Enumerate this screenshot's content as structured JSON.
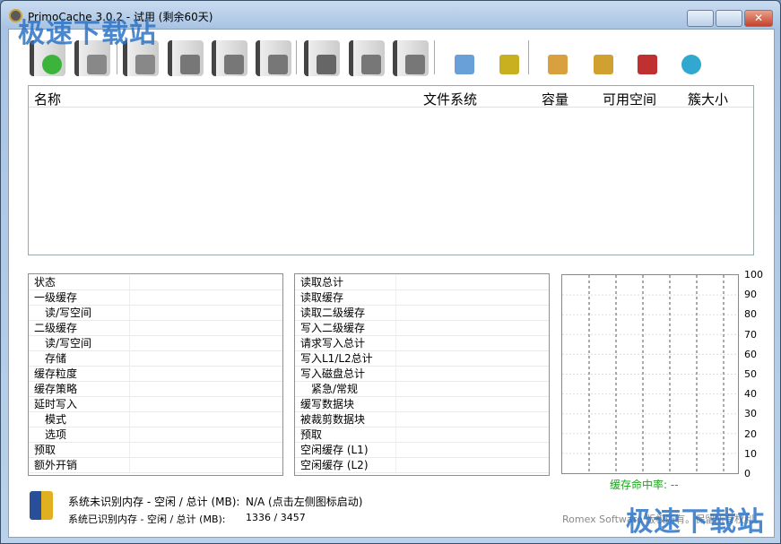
{
  "window": {
    "title": "PrimoCache 3.0.2 - 试用 (剩余60天)",
    "minimize": "—",
    "maximize": "□",
    "close": "✕"
  },
  "watermark": "极速下载站",
  "toolbar": [
    {
      "icon": "add-disk-icon",
      "color": "#3cb43c"
    },
    {
      "icon": "disk-options-icon",
      "color": "#888"
    },
    {
      "icon": "disk-search-icon",
      "color": "#888"
    },
    {
      "icon": "disk-delete-icon",
      "color": "#777"
    },
    {
      "icon": "disk-pause-icon",
      "color": "#777"
    },
    {
      "icon": "disk-play-icon",
      "color": "#777"
    },
    {
      "icon": "timed-download-icon",
      "color": "#666"
    },
    {
      "icon": "timed-pause-icon",
      "color": "#777"
    },
    {
      "icon": "timed-play-icon",
      "color": "#777"
    },
    {
      "icon": "disk-settings-icon",
      "color": "#6aa0d8"
    },
    {
      "icon": "chip-settings-icon",
      "color": "#c8b020"
    },
    {
      "icon": "package-settings-icon",
      "color": "#d9a040"
    },
    {
      "icon": "lock-key-icon",
      "color": "#d0a030"
    },
    {
      "icon": "help-book-icon",
      "color": "#c03030"
    },
    {
      "icon": "info-icon",
      "color": "#30a8d0"
    }
  ],
  "list": {
    "columns": [
      "名称",
      "文件系统",
      "容量",
      "可用空间",
      "簇大小"
    ]
  },
  "left_panel": [
    "状态",
    "一级缓存",
    "读/写空间",
    "二级缓存",
    "读/写空间",
    "存储",
    "缓存粒度",
    "缓存策略",
    "延时写入",
    "模式",
    "选项",
    "预取",
    "额外开销"
  ],
  "left_indent": [
    0,
    0,
    1,
    0,
    1,
    1,
    0,
    0,
    0,
    1,
    1,
    0,
    0
  ],
  "mid_panel": [
    "读取总计",
    "读取缓存",
    "读取二级缓存",
    "写入二级缓存",
    "请求写入总计",
    "写入L1/L2总计",
    "写入磁盘总计",
    "紧急/常规",
    "缓写数据块",
    "被裁剪数据块",
    "预取",
    "空闲缓存 (L1)",
    "空闲缓存 (L2)"
  ],
  "mid_indent": [
    0,
    0,
    0,
    0,
    0,
    0,
    0,
    1,
    0,
    0,
    0,
    0,
    0
  ],
  "chart": {
    "y_ticks": [
      "100",
      "90",
      "80",
      "70",
      "60",
      "50",
      "40",
      "30",
      "20",
      "10",
      "0"
    ],
    "hit_rate": "缓存命中率: --"
  },
  "memory": {
    "unrecognized_label": "系统未识别内存 - 空闲 / 总计 (MB):",
    "unrecognized_value": "N/A (点击左侧图标启动)",
    "recognized_label": "系统已识别内存 - 空闲 / 总计 (MB):",
    "recognized_value": "1336 / 3457"
  },
  "footer": "Romex Software 版权所有。保留所有权利。"
}
